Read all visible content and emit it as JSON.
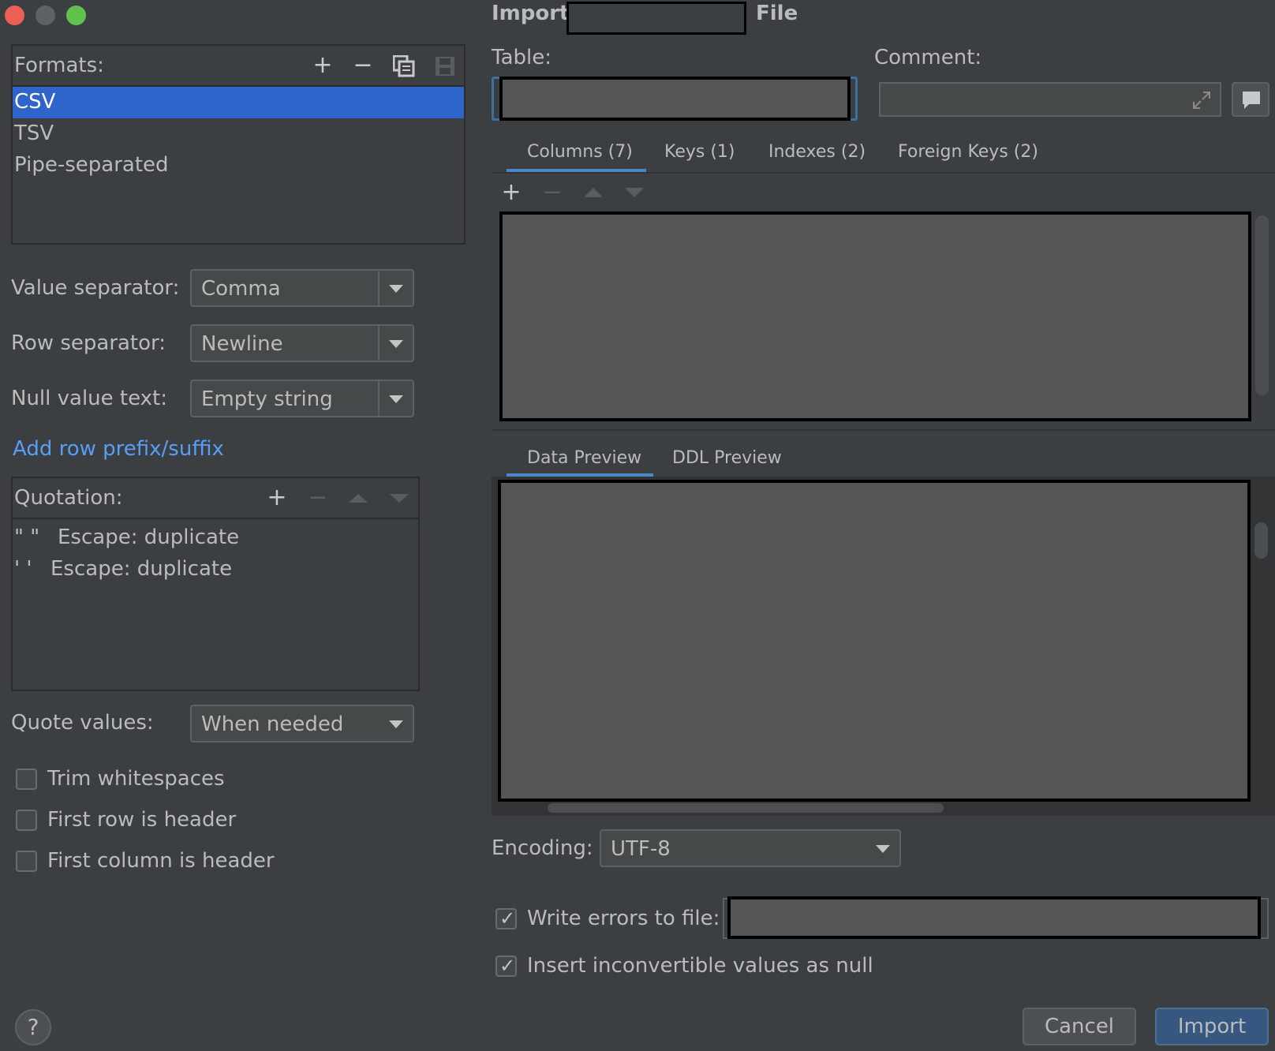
{
  "window": {
    "title_prefix": "Import",
    "title_suffix": "File"
  },
  "formats": {
    "label": "Formats:",
    "items": [
      "CSV",
      "TSV",
      "Pipe-separated"
    ],
    "selected_index": 0,
    "tools": [
      "plus-icon",
      "minus-icon",
      "copy-icon",
      "save-icon"
    ]
  },
  "separators": {
    "value_label": "Value separator:",
    "value": "Comma",
    "row_label": "Row separator:",
    "row": "Newline",
    "null_label": "Null value text:",
    "null": "Empty string"
  },
  "prefix_link": "Add row prefix/suffix",
  "quotation": {
    "label": "Quotation:",
    "rows": [
      {
        "quote": "\"  \"",
        "escape": "Escape: duplicate"
      },
      {
        "quote": "'  '",
        "escape": "Escape: duplicate"
      }
    ]
  },
  "quote_values": {
    "label": "Quote values:",
    "value": "When needed"
  },
  "options": [
    {
      "label": "Trim whitespaces",
      "checked": false
    },
    {
      "label": "First row is header",
      "checked": false
    },
    {
      "label": "First column is header",
      "checked": false
    }
  ],
  "table": {
    "label": "Table:"
  },
  "comment": {
    "label": "Comment:"
  },
  "top_tabs": [
    "Columns (7)",
    "Keys (1)",
    "Indexes (2)",
    "Foreign Keys (2)"
  ],
  "preview_tabs": [
    "Data Preview",
    "DDL Preview"
  ],
  "encoding": {
    "label": "Encoding:",
    "value": "UTF-8"
  },
  "errors": {
    "label": "Write errors to file:",
    "checked": true
  },
  "inconvertible": {
    "label": "Insert inconvertible values as null",
    "checked": true
  },
  "buttons": {
    "cancel": "Cancel",
    "import": "Import",
    "help": "?"
  },
  "colors": {
    "accent": "#2f65ca",
    "link": "#589df6",
    "primary_button": "#365880"
  }
}
